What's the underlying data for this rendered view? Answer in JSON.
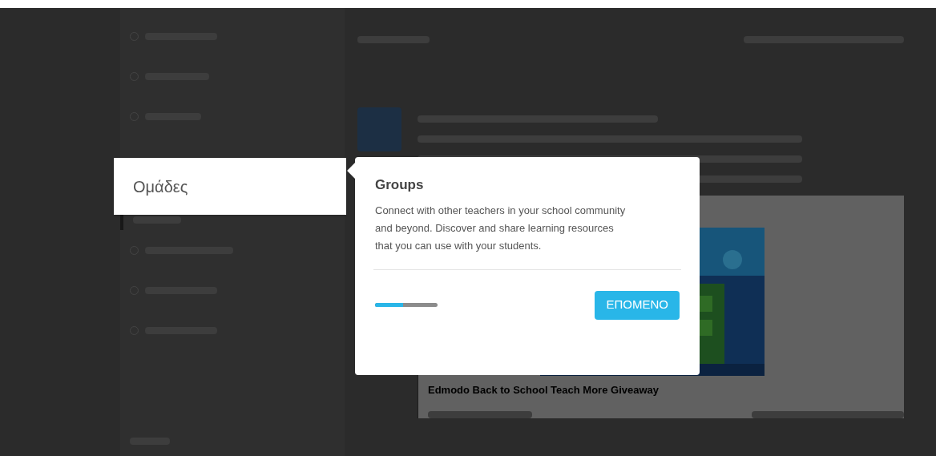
{
  "spotlight": {
    "label": "Ομάδες"
  },
  "tour": {
    "title": "Groups",
    "body": "Connect with other teachers in your school community and beyond. Discover and share learning resources that you can use with your students.",
    "progress": {
      "level": 0.45
    },
    "next_button": "ΕΠΟΜΕΝΟ"
  },
  "post": {
    "title": "Edmodo Back to School Teach More Giveaway"
  }
}
